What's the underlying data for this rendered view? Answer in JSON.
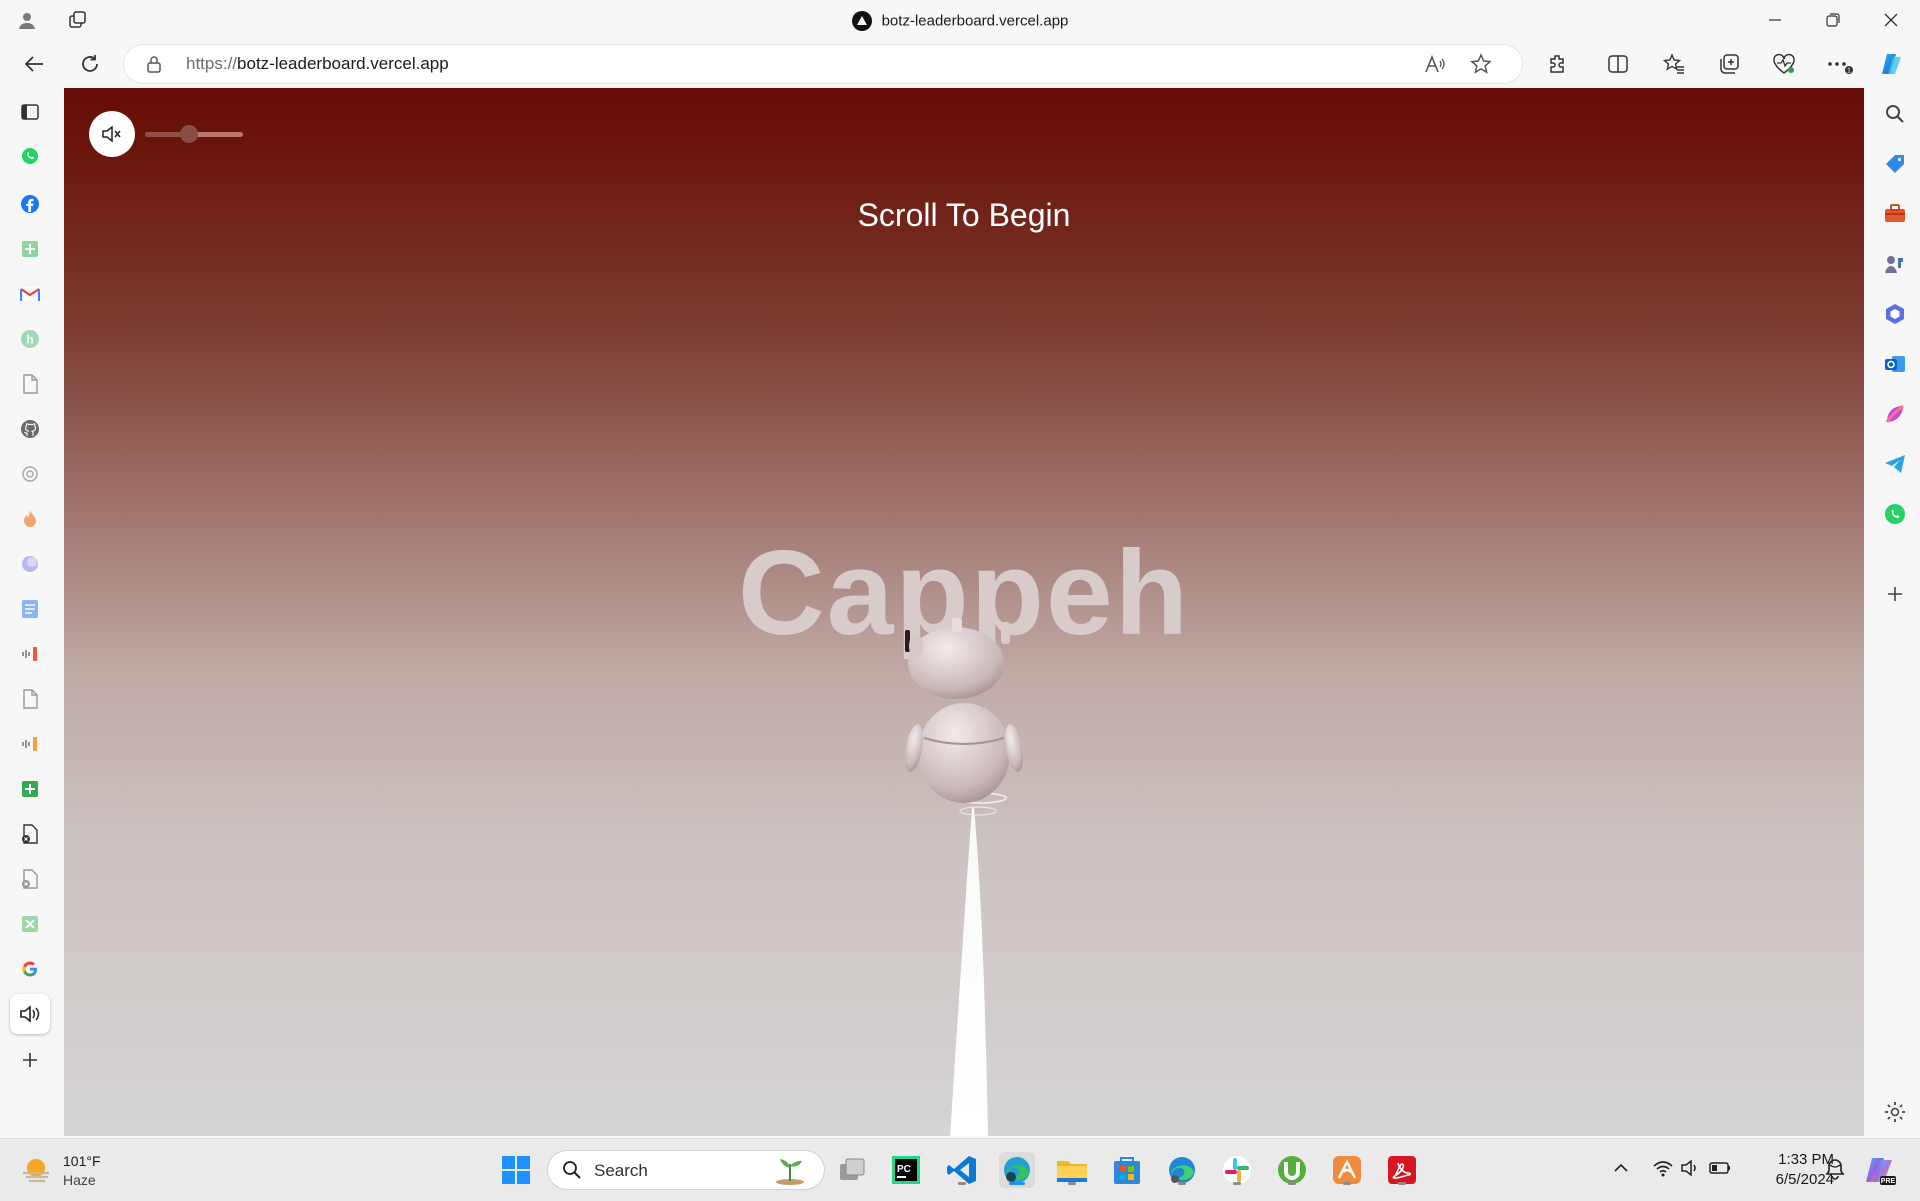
{
  "window": {
    "title": "botz-leaderboard.vercel.app"
  },
  "address_bar": {
    "url_protocol": "https://",
    "url_host": "botz-leaderboard.vercel.app"
  },
  "page": {
    "prompt_text": "Scroll To Begin",
    "brand_text": "Cappeh",
    "volume_level": 0.45,
    "audio_muted": true
  },
  "taskbar": {
    "weather_temp": "101°F",
    "weather_desc": "Haze",
    "search_label": "Search",
    "time": "1:33 PM",
    "date": "6/5/2024"
  },
  "colors": {
    "accent": "#0a66c2",
    "content_top": "#650b05",
    "content_bottom": "#d6d4d4"
  }
}
